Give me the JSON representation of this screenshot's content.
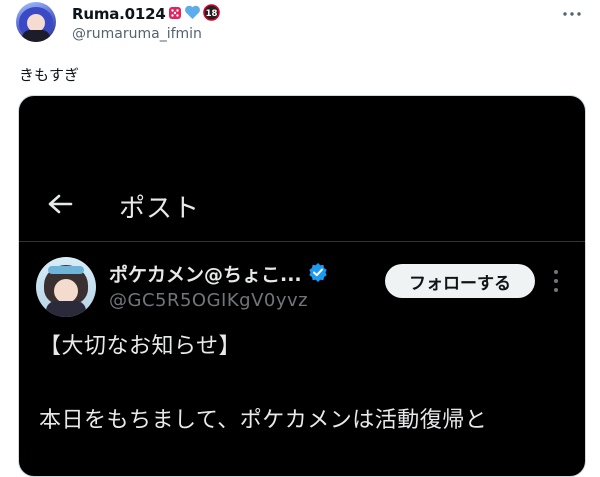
{
  "tweet": {
    "author": {
      "display_name": "Ruma.0124",
      "handle": "@rumaruma_ifmin",
      "badges": [
        "dice-icon",
        "blue-heart-icon",
        "r18-icon"
      ]
    },
    "text": "きもすぎ"
  },
  "embedded_screenshot": {
    "header_title": "ポスト",
    "author": {
      "display_name": "ポケカメン@ちょこ...",
      "handle": "@GC5R5OGIKgV0yvz",
      "verified": true
    },
    "follow_label": "フォローする",
    "notice": "【大切なお知らせ】",
    "body": "本日をもちまして、ポケカメンは活動復帰と"
  },
  "colors": {
    "text_primary": "#0f1419",
    "text_secondary": "#536471",
    "verified": "#1d9bf0",
    "dark_bg": "#000000"
  }
}
